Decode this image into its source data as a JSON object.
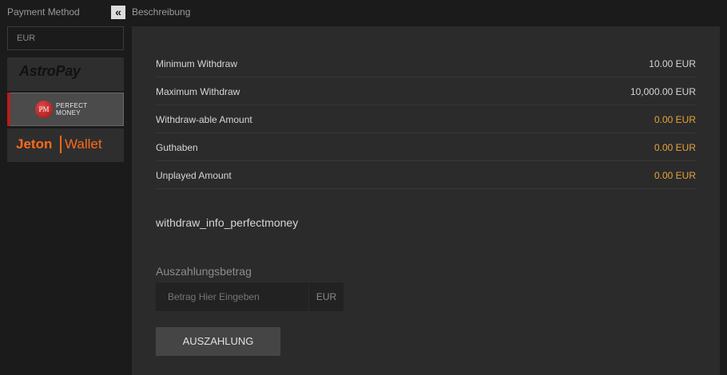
{
  "sidebar": {
    "title": "Payment Method",
    "currency": "EUR",
    "methods": [
      {
        "name": "AstroPay",
        "selected": false
      },
      {
        "name_line1": "PERFECT",
        "name_line2": "MONEY",
        "badge": "PM",
        "selected": true
      },
      {
        "name_part1": "Jeton",
        "name_part2": "Wallet",
        "selected": false
      }
    ]
  },
  "description": {
    "title": "Beschreibung"
  },
  "limits": [
    {
      "label": "Minimum Withdraw",
      "value": "10.00 EUR"
    },
    {
      "label": "Maximum Withdraw",
      "value": "10,000.00 EUR"
    },
    {
      "label": "Withdraw-able Amount",
      "value": "0.00 EUR"
    },
    {
      "label": "Guthaben",
      "value": "0.00 EUR"
    },
    {
      "label": "Unplayed Amount",
      "value": "0.00 EUR"
    }
  ],
  "info_key": "withdraw_info_perfectmoney",
  "form": {
    "amount_label": "Auszahlungsbetrag",
    "amount_placeholder": "Betrag Hier Eingeben",
    "currency": "EUR",
    "submit_label": "AUSZAHLUNG"
  },
  "colors": {
    "accent_value": "#e8a33a",
    "selected_marker": "#b51e1e",
    "jeton_orange": "#ff6a1a"
  }
}
